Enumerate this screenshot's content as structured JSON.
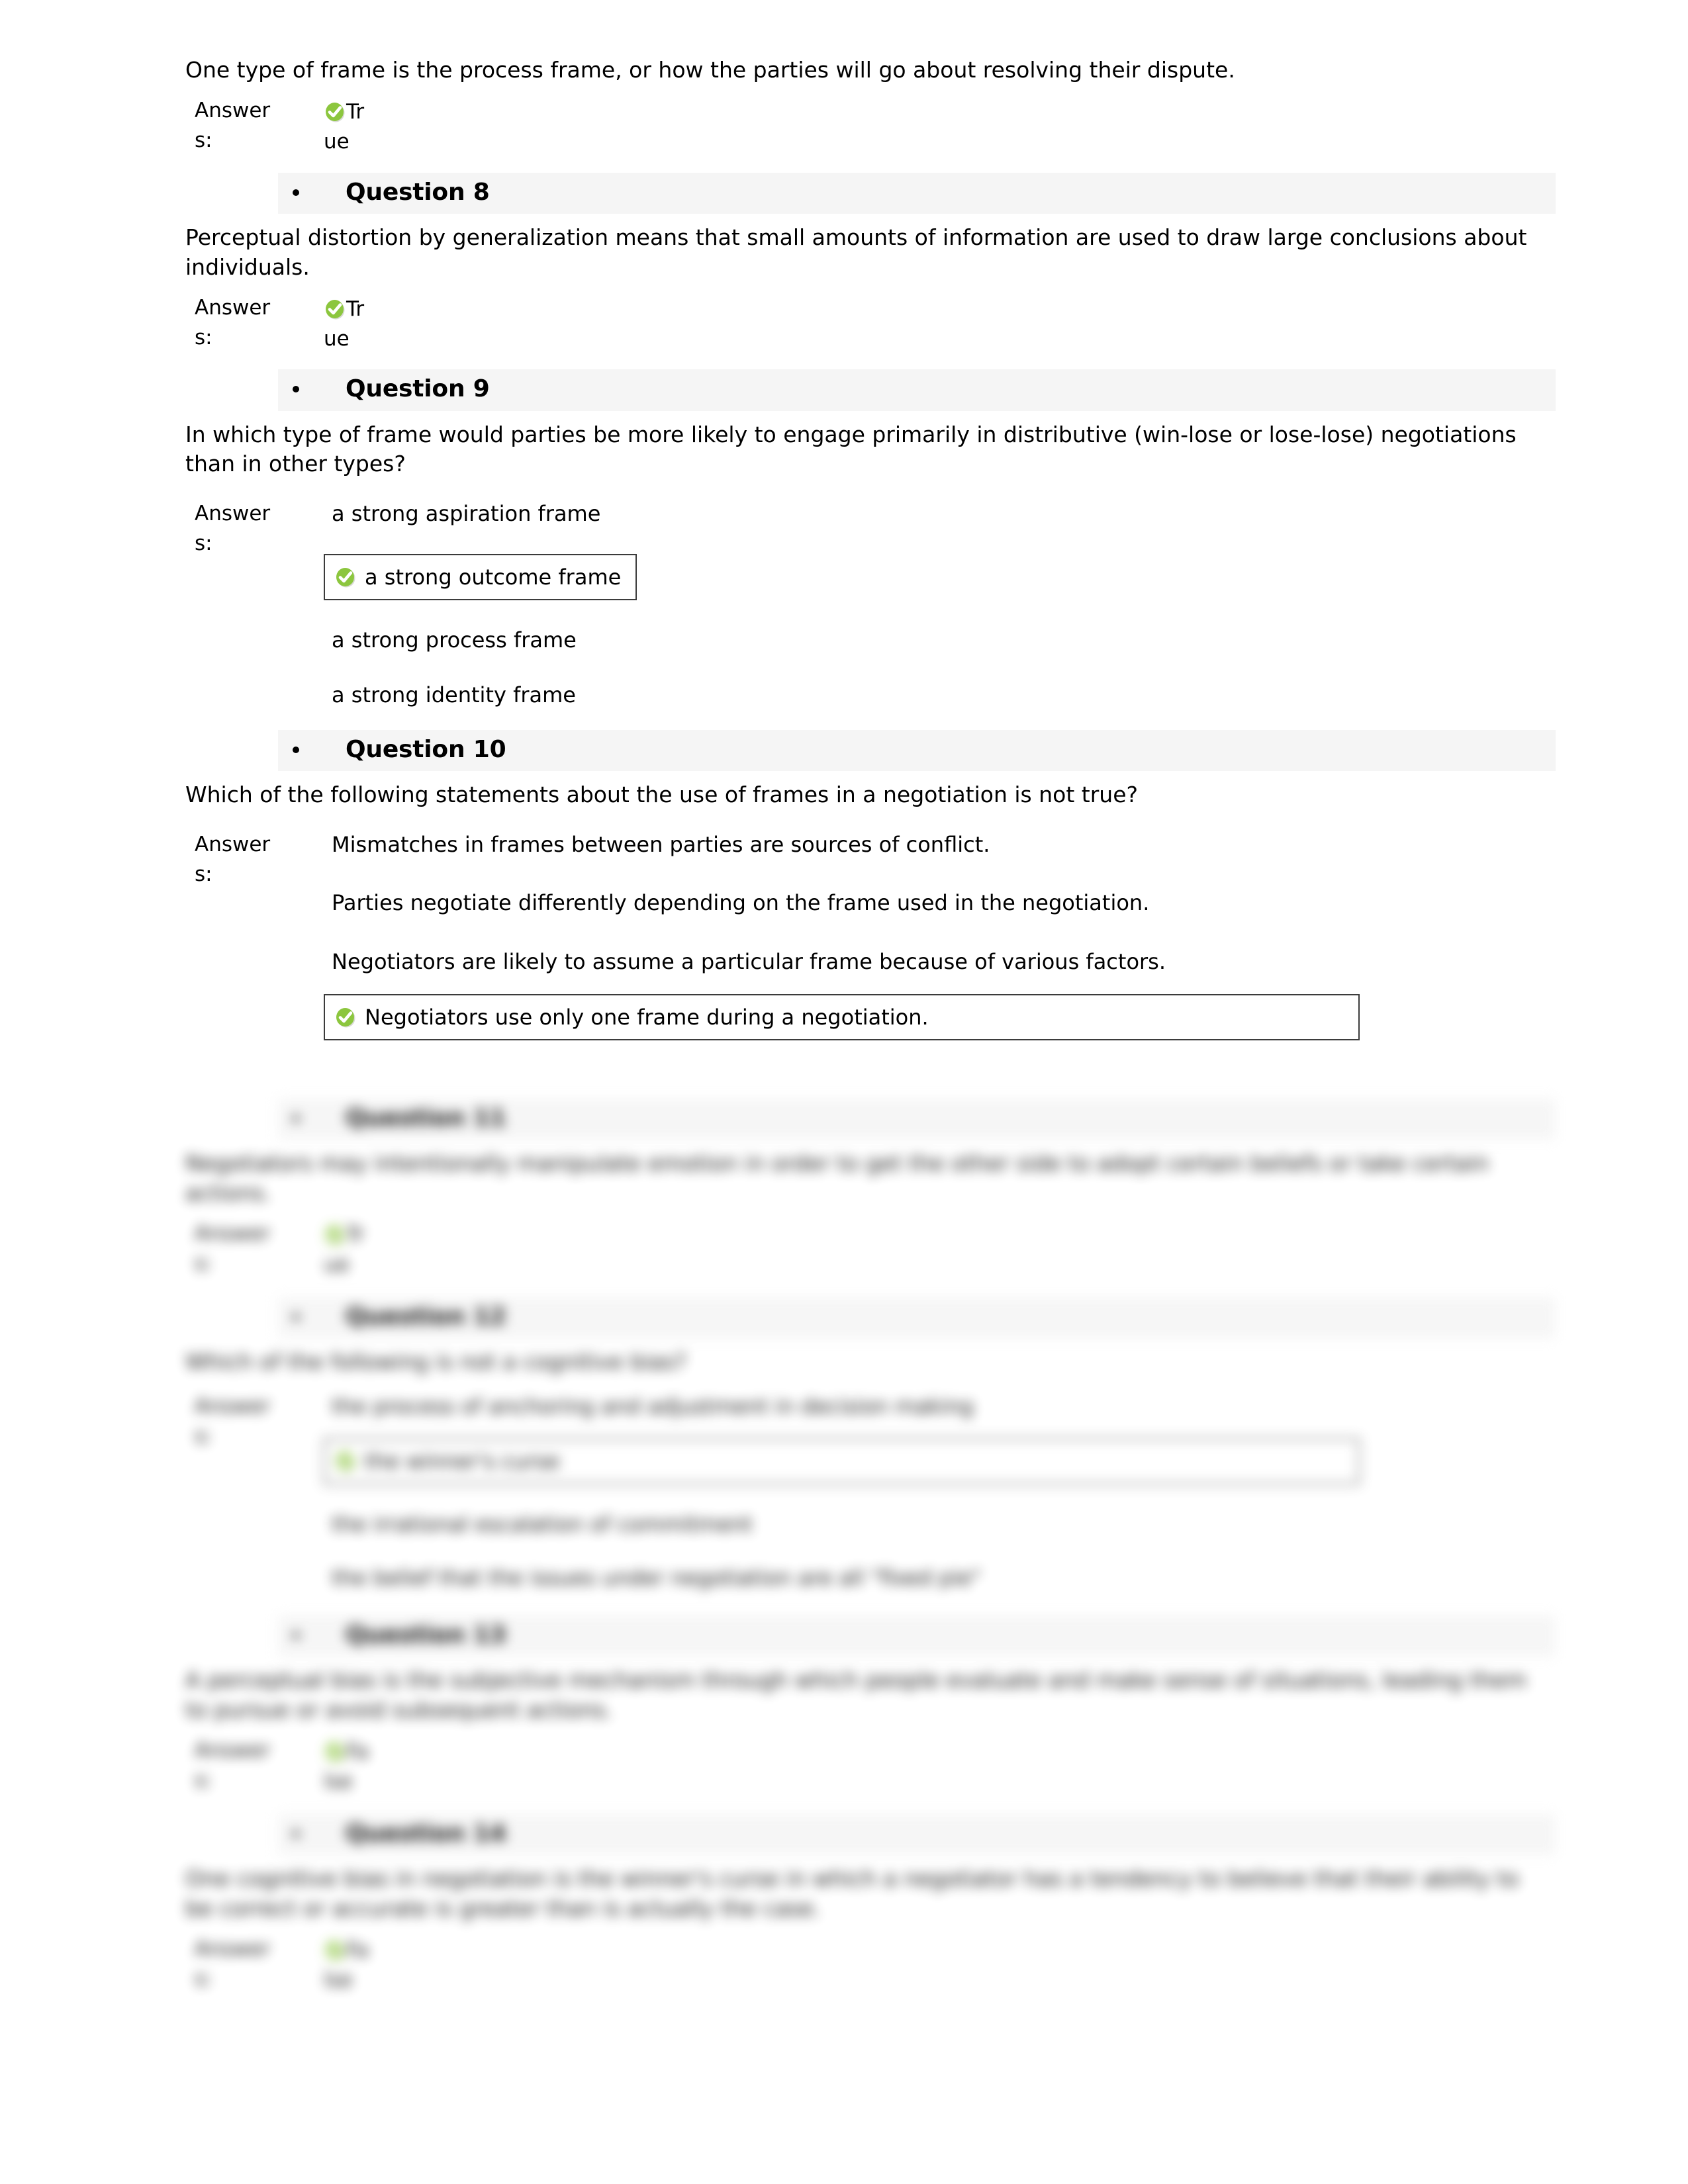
{
  "document": {
    "background_color": "#ffffff",
    "header_band_color": "#f5f5f5",
    "check_icon_color": "#8cc63e",
    "check_icon_name": "green-check-circle-icon",
    "answers_label": "Answers:",
    "answers_label_line1": "Answer",
    "answers_label_line2": "s:"
  },
  "q7_tail": {
    "stem": "One type of frame is the process frame, or how the parties will go about resolving their dispute.",
    "answer_line1": "Tru",
    "answer_line2": "e"
  },
  "questions": [
    {
      "title": "Question 8",
      "stem": "Perceptual distortion by generalization means that small amounts of information are used to draw large conclusions about individuals.",
      "type": "true-false",
      "answer_line1": "Tru",
      "answer_line2": "e"
    },
    {
      "title": "Question 9",
      "stem": "In which type of frame would parties be more likely to engage primarily in distributive (win-lose or lose-lose) negotiations than in other types?",
      "type": "multiple-choice",
      "options": [
        {
          "label": "a strong aspiration frame",
          "selected": false
        },
        {
          "label": "a strong outcome frame",
          "selected": true
        },
        {
          "label": "a strong process frame",
          "selected": false
        },
        {
          "label": "a strong identity frame",
          "selected": false
        }
      ]
    },
    {
      "title": "Question 10",
      "stem": "Which of the following statements about the use of frames in a negotiation is not true?",
      "type": "multiple-choice",
      "options": [
        {
          "label": "Mismatches in frames between parties are sources of conflict.",
          "selected": false
        },
        {
          "label": "Parties negotiate differently depending on the frame used in the negotiation.",
          "selected": false
        },
        {
          "label": "Negotiators are likely to assume a particular frame because of various factors.",
          "selected": false
        },
        {
          "label": "Negotiators use only one frame during a negotiation.",
          "selected": true
        }
      ]
    },
    {
      "title": "Question 11",
      "stem": "Negotiators may intentionally manipulate emotion in order to get the other side to adopt certain beliefs or take certain actions.",
      "type": "true-false",
      "answer_line1": "Tru",
      "answer_line2": "e"
    },
    {
      "title": "Question 12",
      "stem": "Which of the following is not a cognitive bias?",
      "type": "multiple-choice",
      "options": [
        {
          "label": "the process of anchoring and adjustment in decision making",
          "selected": false
        },
        {
          "label": "the winner's curse",
          "selected": true
        },
        {
          "label": "the irrational escalation of commitment",
          "selected": false
        },
        {
          "label": "the belief that the issues under negotiation are all \"fixed pie\"",
          "selected": false
        }
      ]
    },
    {
      "title": "Question 13",
      "stem": "A perceptual bias is the subjective mechanism through which people evaluate and make sense of situations, leading them to pursue or avoid subsequent actions.",
      "type": "true-false",
      "answer_line1": "Fals",
      "answer_line2": "e"
    },
    {
      "title": "Question 14",
      "stem": "One cognitive bias in negotiation is the winner's curse in which a negotiator has a tendency to believe that their ability to be correct or accurate is greater than is actually the case.",
      "type": "true-false",
      "answer_line1": "Fals",
      "answer_line2": "e"
    }
  ]
}
